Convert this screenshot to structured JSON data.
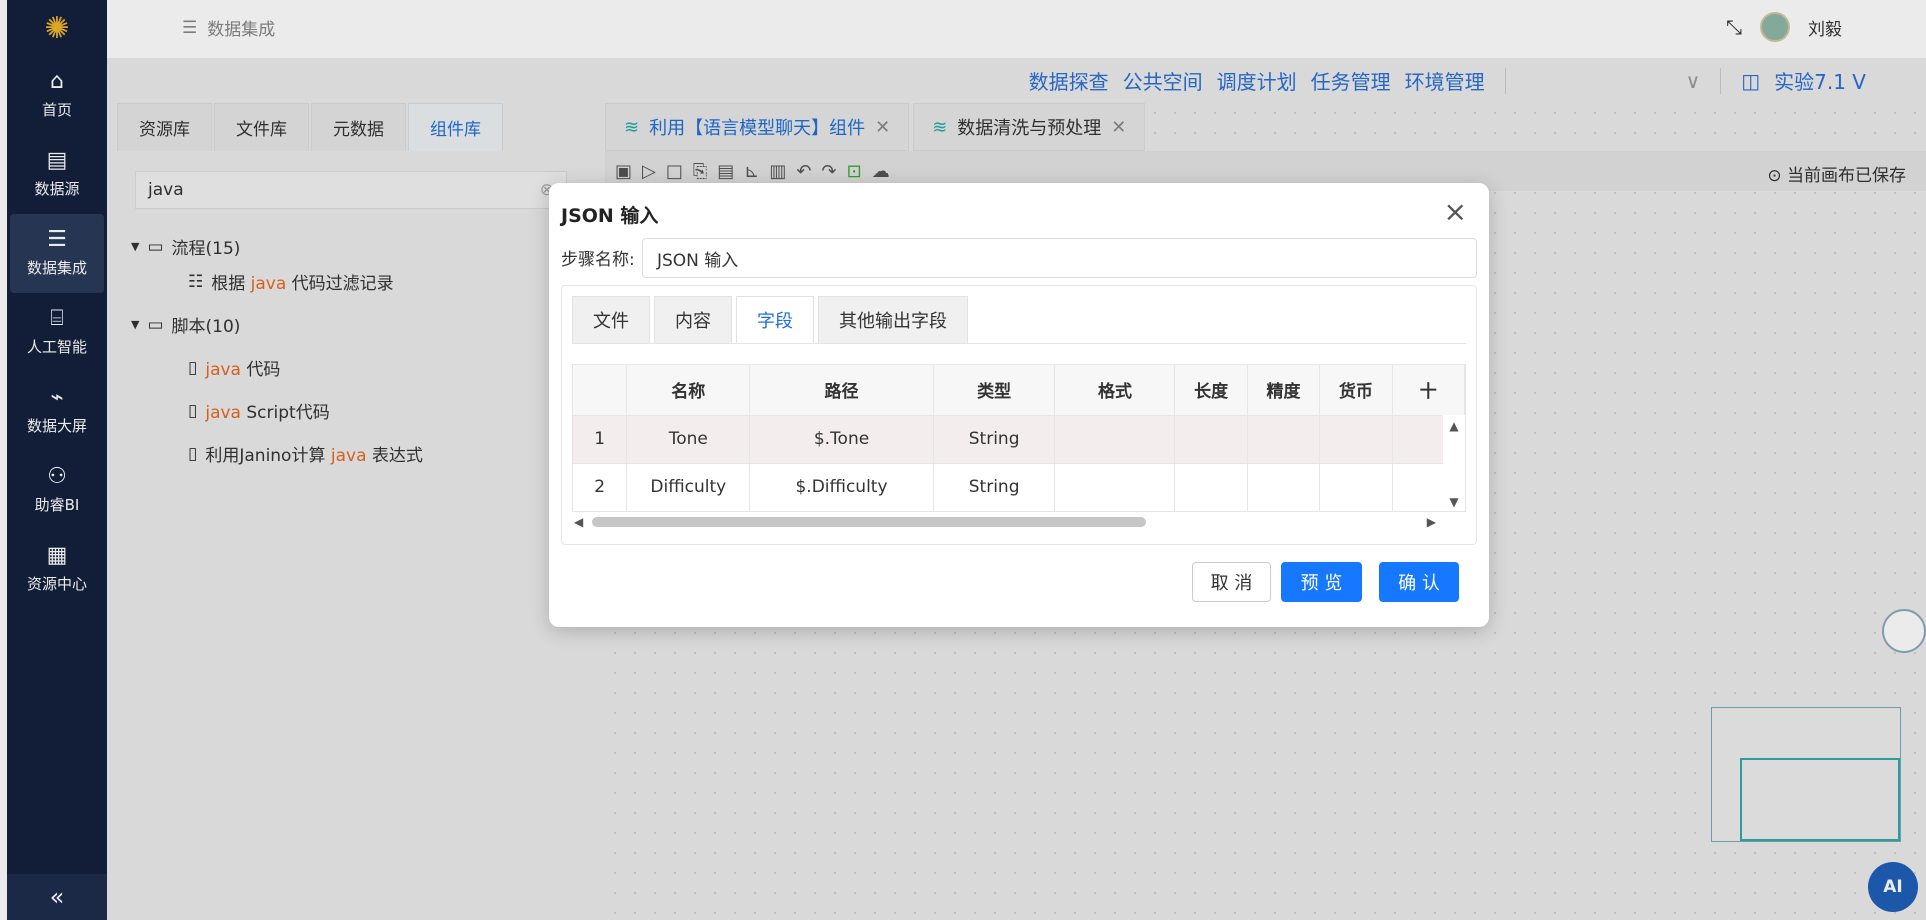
{
  "sidebar": {
    "items": [
      {
        "label": "首页",
        "icon": "home-icon"
      },
      {
        "label": "数据源",
        "icon": "database-icon"
      },
      {
        "label": "数据集成",
        "icon": "integration-icon"
      },
      {
        "label": "人工智能",
        "icon": "ai-icon"
      },
      {
        "label": "数据大屏",
        "icon": "chart-icon"
      },
      {
        "label": "助睿BI",
        "icon": "org-icon"
      },
      {
        "label": "资源中心",
        "icon": "resource-icon"
      }
    ],
    "collapse": "«"
  },
  "header": {
    "breadcrumb": "数据集成",
    "user": "刘毅"
  },
  "menu": {
    "items": [
      "数据探查",
      "公共空间",
      "调度计划",
      "任务管理",
      "环境管理"
    ],
    "project": "实验7.1 V"
  },
  "left": {
    "tabs": [
      "资源库",
      "文件库",
      "元数据",
      "组件库"
    ],
    "search_value": "java",
    "tree": [
      {
        "label": "流程(15)",
        "children": [
          {
            "pre": "根据 ",
            "hl": "java",
            "post": " 代码过滤记录"
          }
        ]
      },
      {
        "label": "脚本(10)",
        "children": [
          {
            "pre": "",
            "hl": "java",
            "post": " 代码"
          },
          {
            "pre": "",
            "hl": "java",
            "post": " Script代码"
          },
          {
            "pre": "利用Janino计算 ",
            "hl": "java",
            "post": " 表达式"
          }
        ]
      }
    ]
  },
  "canvas": {
    "tabs": [
      "利用【语言模型聊天】组件",
      "数据清洗与预处理"
    ],
    "saved": "当前画布已保存",
    "ai": "AI"
  },
  "modal": {
    "title": "JSON 输入",
    "step_label": "步骤名称:",
    "step_value": "JSON 输入",
    "tabs": [
      "文件",
      "内容",
      "字段",
      "其他输出字段"
    ],
    "columns": [
      "",
      "名称",
      "路径",
      "类型",
      "格式",
      "长度",
      "精度",
      "货币",
      "十"
    ],
    "rows": [
      [
        "1",
        "Tone",
        "$.Tone",
        "String",
        "",
        "",
        "",
        ""
      ],
      [
        "2",
        "Difficulty",
        "$.Difficulty",
        "String",
        "",
        "",
        "",
        ""
      ]
    ],
    "cancel": "取 消",
    "preview": "预 览",
    "confirm": "确 认"
  }
}
